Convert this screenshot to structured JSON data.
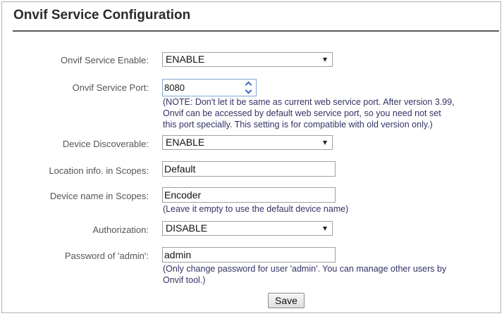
{
  "page": {
    "title": "Onvif Service Configuration"
  },
  "fields": {
    "service_enable": {
      "label": "Onvif Service Enable:",
      "value": "ENABLE"
    },
    "service_port": {
      "label": "Onvif Service Port:",
      "value": "8080",
      "note_line1": "(NOTE: Don't let it be same as current web service port. After version 3.99,",
      "note_line2": "Onvif can be accessed by default web service port, so you need not set",
      "note_line3": "this port specially. This setting is for compatible with old version only.)"
    },
    "device_discoverable": {
      "label": "Device Discoverable:",
      "value": "ENABLE"
    },
    "location_info": {
      "label": "Location info. in Scopes:",
      "value": "Default"
    },
    "device_name": {
      "label": "Device name in Scopes:",
      "value": "Encoder",
      "note": "(Leave it empty to use the default device name)"
    },
    "authorization": {
      "label": "Authorization:",
      "value": "DISABLE"
    },
    "admin_password": {
      "label": "Password of 'admin':",
      "value": "admin",
      "note_line1": "(Only change password for user 'admin'. You can manage other users by",
      "note_line2": "Onvif tool.)"
    }
  },
  "actions": {
    "save_label": "Save"
  },
  "icons": {
    "select_arrow": "chevron-down-icon",
    "spin_up": "chevron-up-icon",
    "spin_down": "chevron-down-icon"
  },
  "colors": {
    "title_rule": "#5a5a5a",
    "note_text": "#333366",
    "spin_accent": "#3a6db0"
  }
}
